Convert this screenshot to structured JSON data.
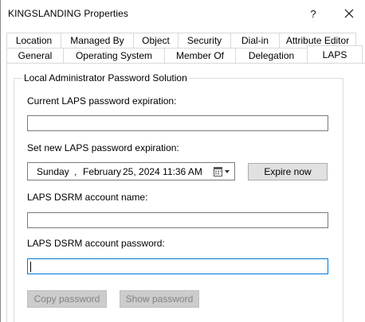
{
  "window": {
    "title": "KINGSLANDING Properties",
    "help_label": "?",
    "close_label": "✕"
  },
  "tabs_back": [
    {
      "label": "Location"
    },
    {
      "label": "Managed By"
    },
    {
      "label": "Object"
    },
    {
      "label": "Security"
    },
    {
      "label": "Dial-in"
    },
    {
      "label": "Attribute Editor"
    }
  ],
  "tabs_front": [
    {
      "label": "General"
    },
    {
      "label": "Operating System"
    },
    {
      "label": "Member Of"
    },
    {
      "label": "Delegation"
    },
    {
      "label": "LAPS",
      "active": true
    }
  ],
  "laps": {
    "group_title": "Local Administrator Password Solution",
    "current_expiration_label": "Current LAPS password expiration:",
    "current_expiration_value": "",
    "set_new_label": "Set new LAPS password expiration:",
    "date": {
      "day": "Sunday",
      "sep": ",",
      "month": "February",
      "rest": "25, 2024 11:36 AM"
    },
    "expire_now_label": "Expire now",
    "dsrm_name_label": "LAPS DSRM account name:",
    "dsrm_name_value": "",
    "dsrm_password_label": "LAPS DSRM account password:",
    "dsrm_password_value": "",
    "copy_password_label": "Copy password",
    "show_password_label": "Show password"
  }
}
